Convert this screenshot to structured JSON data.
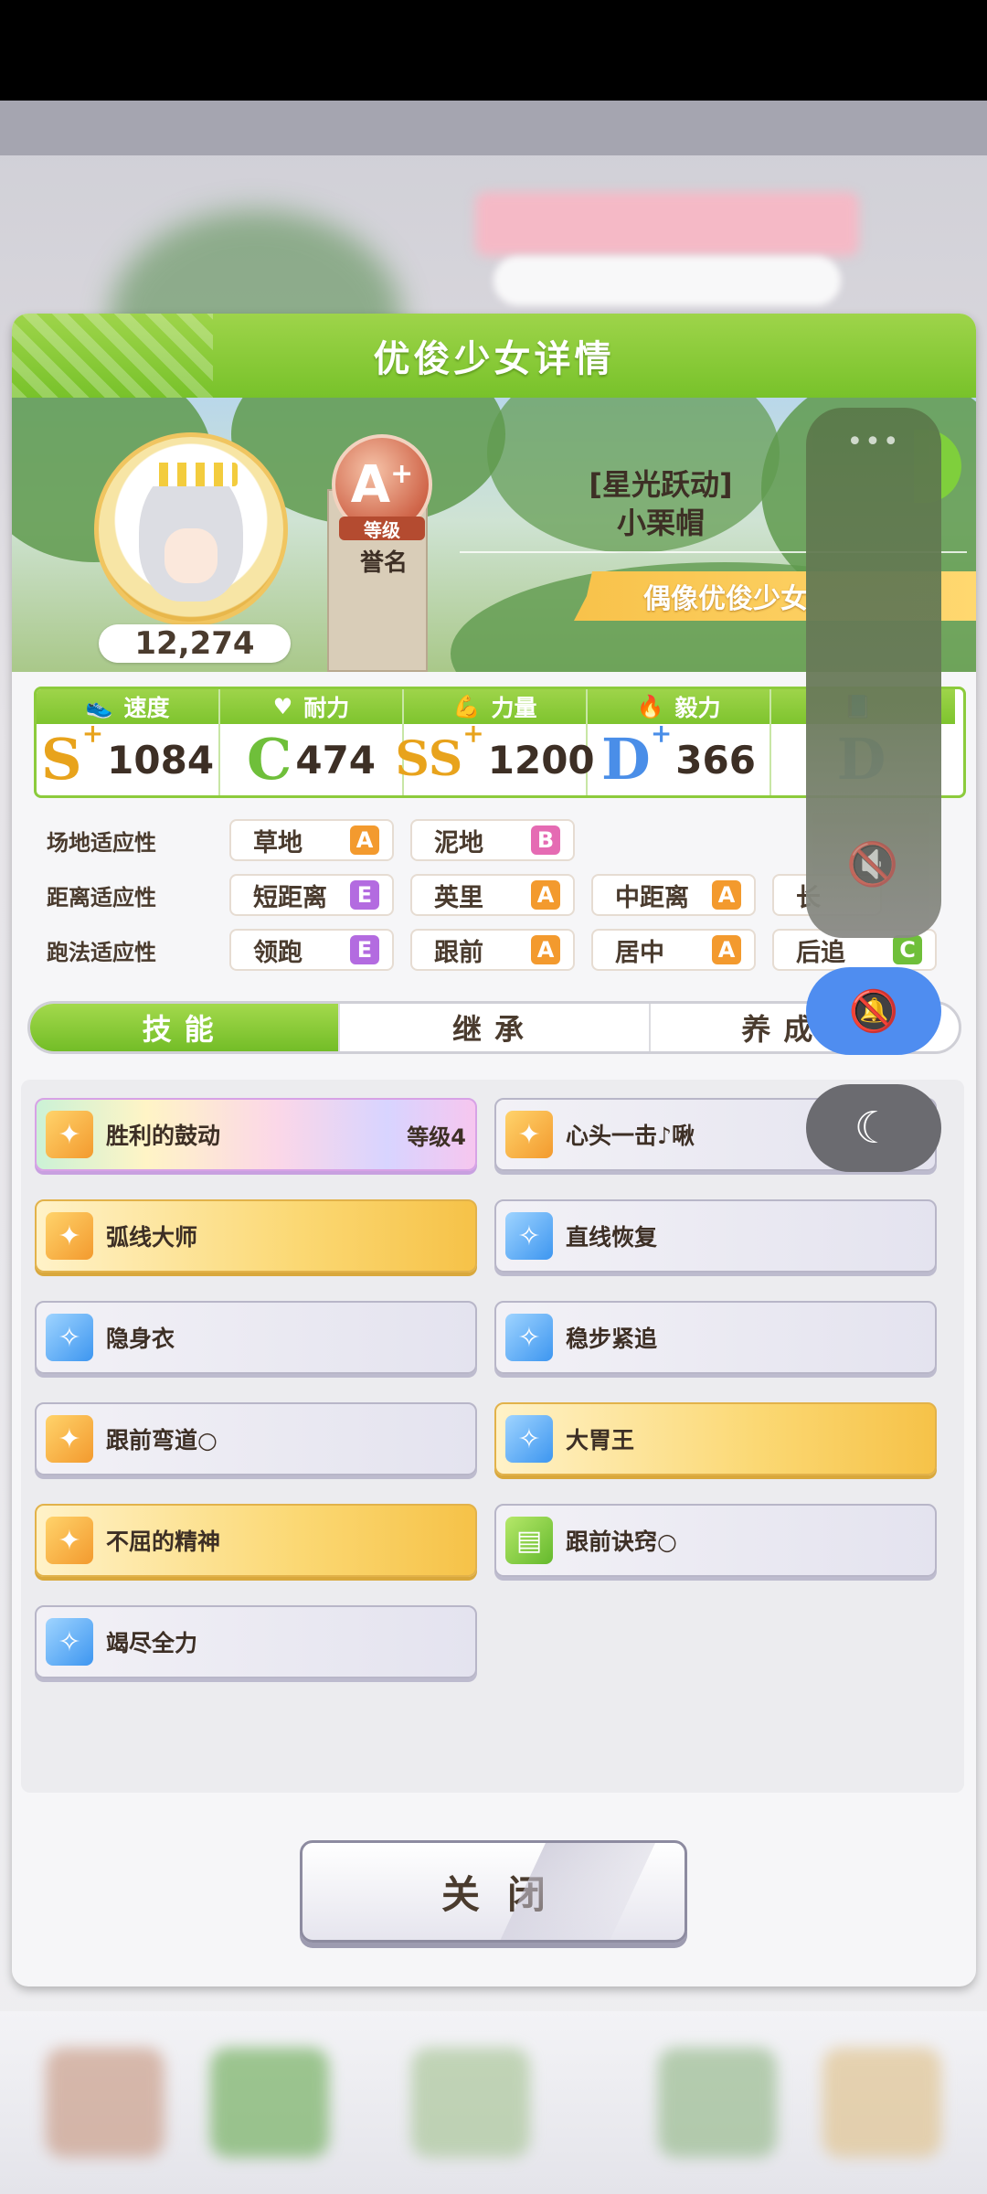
{
  "dialog": {
    "title": "优俊少女详情"
  },
  "profile": {
    "fan_count": "12,274",
    "rank_letter": "A",
    "rank_plus": "+",
    "rank_level_label": "等级",
    "rank_name": "誉名",
    "title": "[星光跃动]",
    "name": "小栗帽",
    "type_banner": "偶像优俊少女"
  },
  "stats": [
    {
      "label": "速度",
      "icon": "shoe-icon",
      "grade": "S",
      "plus": "+",
      "value": "1084"
    },
    {
      "label": "耐力",
      "icon": "heart-icon",
      "grade": "C",
      "plus": "",
      "value": "474"
    },
    {
      "label": "力量",
      "icon": "muscle-icon",
      "grade": "SS",
      "plus": "+",
      "value": "1200"
    },
    {
      "label": "毅力",
      "icon": "flame-icon",
      "grade": "D",
      "plus": "+",
      "value": "366"
    },
    {
      "label": "",
      "icon": "book-icon",
      "grade": "D",
      "plus": "",
      "value": ""
    }
  ],
  "aptitudes": {
    "track": {
      "label": "场地适应性",
      "items": [
        {
          "name": "草地",
          "grade": "A"
        },
        {
          "name": "泥地",
          "grade": "B"
        }
      ]
    },
    "distance": {
      "label": "距离适应性",
      "items": [
        {
          "name": "短距离",
          "grade": "E"
        },
        {
          "name": "英里",
          "grade": "A"
        },
        {
          "name": "中距离",
          "grade": "A"
        },
        {
          "name": "长",
          "grade": ""
        }
      ]
    },
    "style": {
      "label": "跑法适应性",
      "items": [
        {
          "name": "领跑",
          "grade": "E"
        },
        {
          "name": "跟前",
          "grade": "A"
        },
        {
          "name": "居中",
          "grade": "A"
        },
        {
          "name": "后追",
          "grade": "C"
        }
      ]
    }
  },
  "tabs": [
    {
      "label": "技能"
    },
    {
      "label": "继承"
    },
    {
      "label": "养成信"
    }
  ],
  "skills": [
    {
      "name": "胜利的鼓动",
      "level": "等级4",
      "style": "rainbow",
      "icon": "orange"
    },
    {
      "name": "心头一击♪啾",
      "level": "",
      "style": "plain",
      "icon": "orange"
    },
    {
      "name": "弧线大师",
      "level": "",
      "style": "gold",
      "icon": "orange"
    },
    {
      "name": "直线恢复",
      "level": "",
      "style": "plain",
      "icon": "blue"
    },
    {
      "name": "隐身衣",
      "level": "",
      "style": "plain",
      "icon": "blue"
    },
    {
      "name": "稳步紧追",
      "level": "",
      "style": "plain",
      "icon": "blue"
    },
    {
      "name": "跟前弯道○",
      "level": "",
      "style": "plain",
      "icon": "orange"
    },
    {
      "name": "大胃王",
      "level": "",
      "style": "gold",
      "icon": "blue"
    },
    {
      "name": "不屈的精神",
      "level": "",
      "style": "gold",
      "icon": "orange"
    },
    {
      "name": "跟前诀窍○",
      "level": "",
      "style": "plain",
      "icon": "green"
    },
    {
      "name": "竭尽全力",
      "level": "",
      "style": "plain",
      "icon": "blue"
    }
  ],
  "close_button": {
    "label": "关闭"
  },
  "overlay": {
    "dots": "•••"
  }
}
